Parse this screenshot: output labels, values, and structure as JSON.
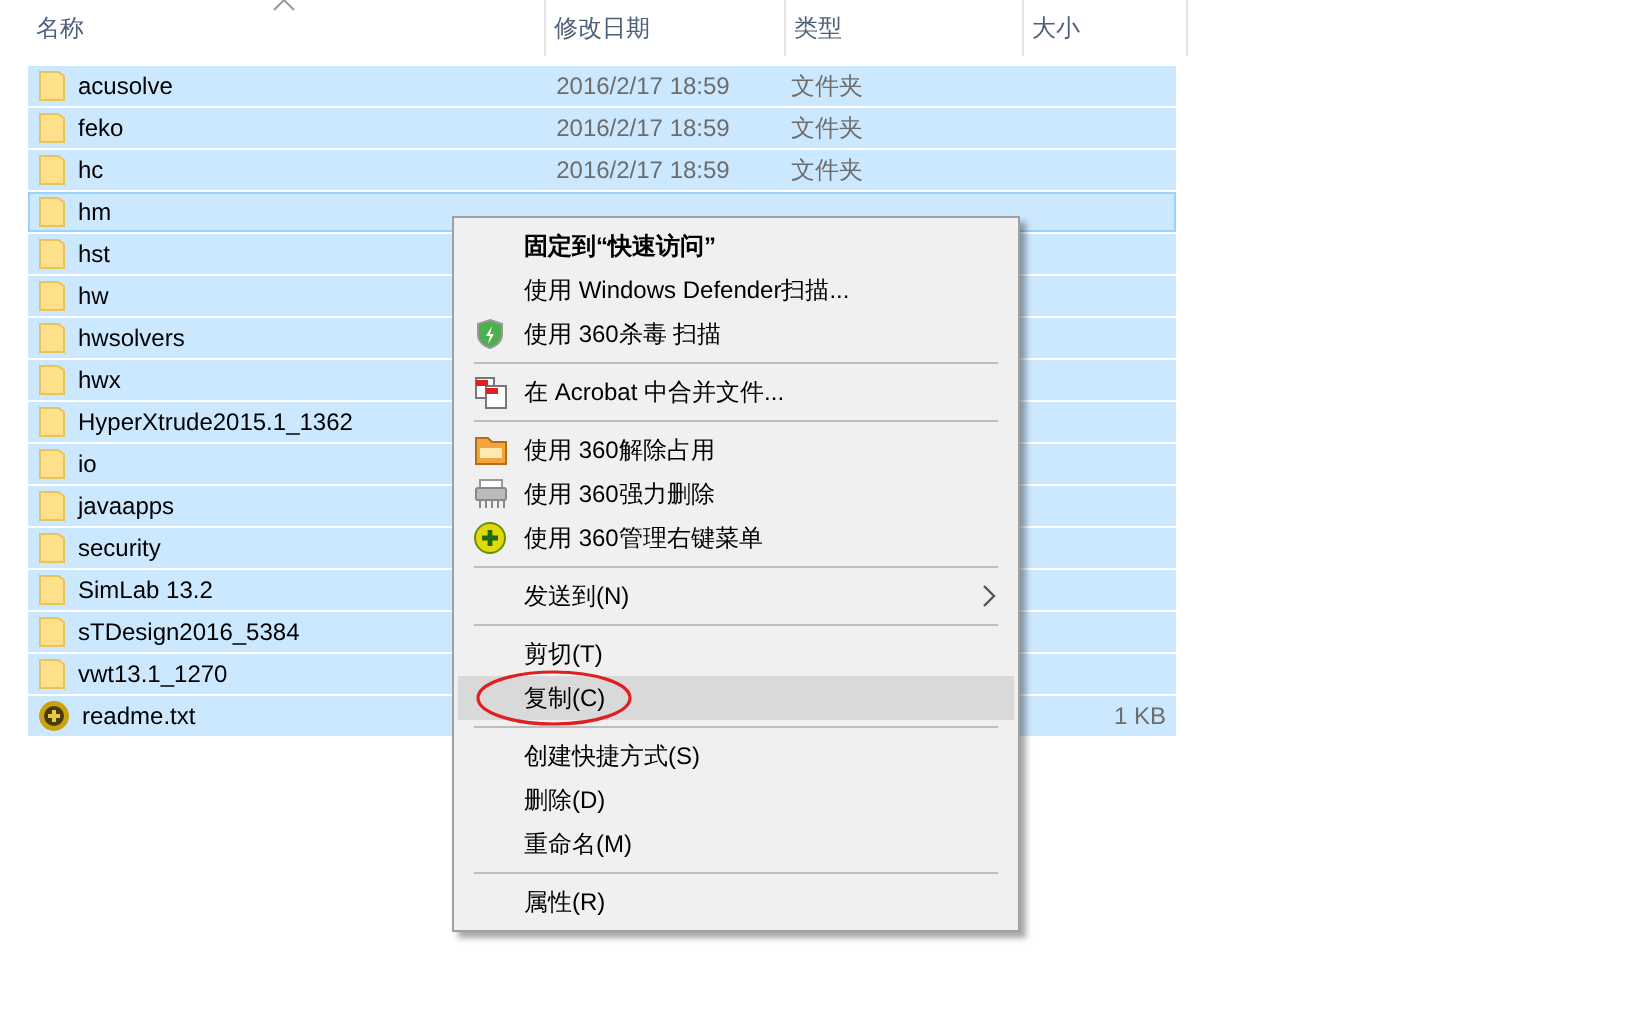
{
  "columns": [
    {
      "label": "名称",
      "sorted": true
    },
    {
      "label": "修改日期",
      "sorted": false
    },
    {
      "label": "类型",
      "sorted": false
    },
    {
      "label": "大小",
      "sorted": false
    }
  ],
  "files": [
    {
      "name": "acusolve",
      "kind": "folder",
      "date": "2016/2/17 18:59",
      "type": "文件夹",
      "selected": true,
      "focused": false
    },
    {
      "name": "feko",
      "kind": "folder",
      "date": "2016/2/17 18:59",
      "type": "文件夹",
      "selected": true,
      "focused": false
    },
    {
      "name": "hc",
      "kind": "folder",
      "date": "2016/2/17 18:59",
      "type": "文件夹",
      "selected": true,
      "focused": false
    },
    {
      "name": "hm",
      "kind": "folder",
      "selected": true,
      "focused": true
    },
    {
      "name": "hst",
      "kind": "folder",
      "selected": true,
      "focused": false
    },
    {
      "name": "hw",
      "kind": "folder",
      "selected": true,
      "focused": false
    },
    {
      "name": "hwsolvers",
      "kind": "folder",
      "selected": true,
      "focused": false
    },
    {
      "name": "hwx",
      "kind": "folder",
      "selected": true,
      "focused": false
    },
    {
      "name": "HyperXtrude2015.1_1362",
      "kind": "folder",
      "selected": true,
      "focused": false
    },
    {
      "name": "io",
      "kind": "folder",
      "selected": true,
      "focused": false
    },
    {
      "name": "javaapps",
      "kind": "folder",
      "selected": true,
      "focused": false
    },
    {
      "name": "security",
      "kind": "folder",
      "selected": true,
      "focused": false
    },
    {
      "name": "SimLab 13.2",
      "kind": "folder",
      "selected": true,
      "focused": false
    },
    {
      "name": "sTDesign2016_5384",
      "kind": "folder",
      "selected": true,
      "focused": false
    },
    {
      "name": "vwt13.1_1270",
      "kind": "folder",
      "selected": true,
      "focused": false
    },
    {
      "name": "readme.txt",
      "kind": "file",
      "size": "1 KB",
      "selected": true,
      "focused": false
    }
  ],
  "context_menu": {
    "items": [
      {
        "kind": "item",
        "label": "固定到“快速访问”",
        "default": true,
        "selected": false
      },
      {
        "kind": "item",
        "label": "使用 Windows Defender扫描...",
        "selected": false
      },
      {
        "kind": "item",
        "label": "使用 360杀毒 扫描",
        "selected": false
      },
      {
        "kind": "separator"
      },
      {
        "kind": "item",
        "label": "在 Acrobat 中合并文件...",
        "selected": false
      },
      {
        "kind": "separator"
      },
      {
        "kind": "item",
        "label": "使用 360解除占用",
        "selected": false
      },
      {
        "kind": "item",
        "label": "使用 360强力删除",
        "selected": false
      },
      {
        "kind": "item",
        "label": "使用 360管理右键菜单",
        "selected": false
      },
      {
        "kind": "separator"
      },
      {
        "kind": "item",
        "label": "发送到(N)",
        "submenu": true,
        "selected": false
      },
      {
        "kind": "separator"
      },
      {
        "kind": "item",
        "label": "剪切(T)",
        "selected": false
      },
      {
        "kind": "item",
        "label": "复制(C)",
        "selected": true,
        "circled": true
      },
      {
        "kind": "separator"
      },
      {
        "kind": "item",
        "label": "创建快捷方式(S)",
        "selected": false
      },
      {
        "kind": "item",
        "label": "删除(D)",
        "selected": false
      },
      {
        "kind": "item",
        "label": "重命名(M)",
        "selected": false
      },
      {
        "kind": "separator"
      },
      {
        "kind": "item",
        "label": "属性(R)",
        "selected": false
      }
    ]
  }
}
